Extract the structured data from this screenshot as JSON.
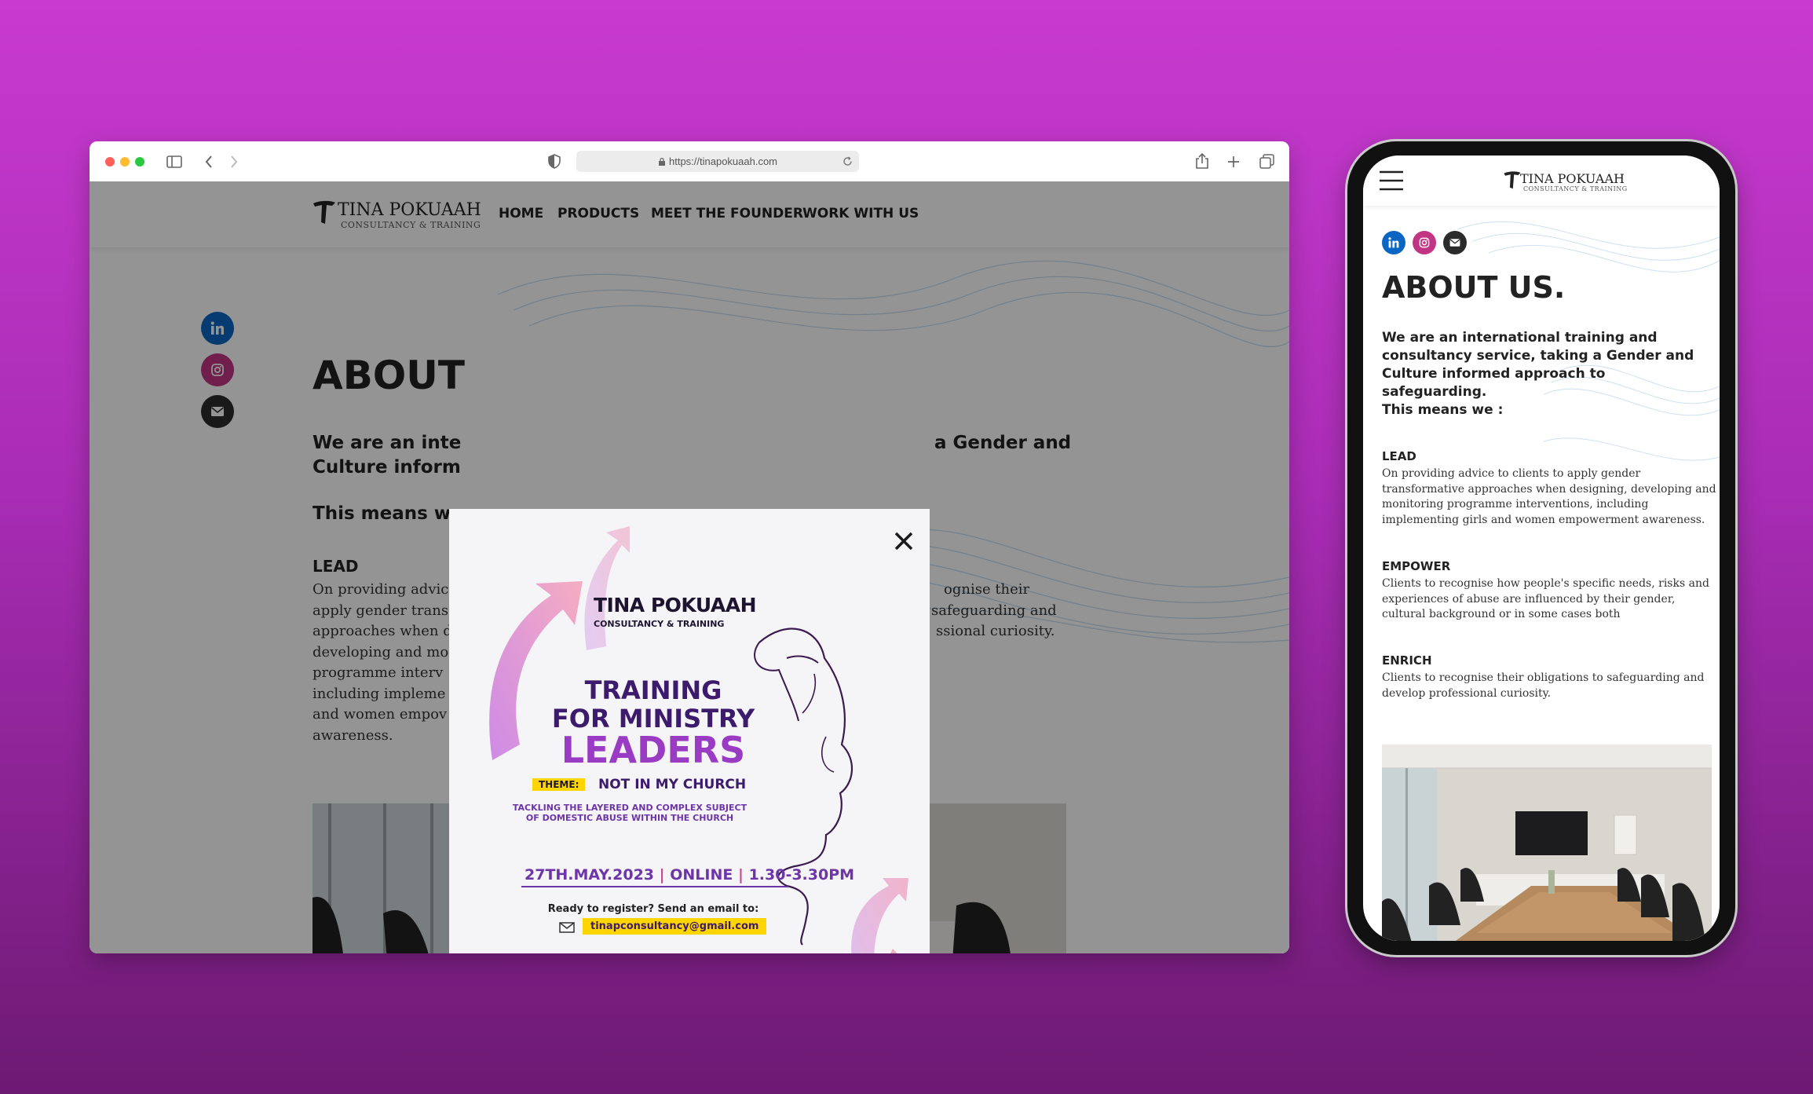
{
  "browser": {
    "url": "https://tinapokuaah.com"
  },
  "brand": {
    "name": "TINA POKUAAH",
    "tagline": "CONSULTANCY & TRAINING"
  },
  "nav": {
    "items": [
      "HOME",
      "PRODUCTS",
      "MEET THE FOUNDER",
      "WORK WITH US"
    ]
  },
  "social": {
    "colors": {
      "linkedin": "#0a66c2",
      "instagram": "#c13584",
      "email": "#2b2b2b"
    }
  },
  "about_desktop": {
    "heading": "ABOUT",
    "lead_left": "We are an inte",
    "lead_left_2": "Culture inform",
    "lead_right": "a Gender and",
    "means": "This means we",
    "lead_title": "LEAD",
    "body_left": [
      "On providing advic",
      "apply gender trans",
      "approaches when d",
      "developing and mo",
      "programme interv",
      "including impleme",
      "and women empov",
      "awareness."
    ],
    "body_right": [
      "ognise their",
      "safeguarding and",
      "ssional curiosity."
    ]
  },
  "popup": {
    "brand": "TINA POKUAAH",
    "brand_sub": "CONSULTANCY & TRAINING",
    "title_1": "TRAINING",
    "title_2": "FOR MINISTRY",
    "title_3": "LEADERS",
    "theme_label": "THEME:",
    "theme_text": "NOT IN MY CHURCH",
    "sub_1": "TACKLING THE LAYERED AND COMPLEX SUBJECT",
    "sub_2": "OF DOMESTIC ABUSE WITHIN THE CHURCH",
    "date": "27TH.MAY.2023",
    "mode": "ONLINE",
    "time": "1.30-3.30PM",
    "ready": "Ready to register? Send an email to:",
    "email": "tinapconsultancy@gmail.com",
    "accent": "#6d35a8",
    "highlight": "#ffd500"
  },
  "about_mobile": {
    "heading": "ABOUT US.",
    "lead": "We are an international training and consultancy service, taking a Gender and Culture informed approach to safeguarding.",
    "means": "This means we :",
    "sections": [
      {
        "title": "LEAD",
        "body": "On providing advice to clients to apply gender transformative approaches when designing, developing and monitoring programme interventions, including implementing girls and women empowerment awareness."
      },
      {
        "title": "EMPOWER",
        "body": "Clients to recognise how people's specific needs, risks and experiences of abuse are influenced by their gender, cultural background or in some cases both"
      },
      {
        "title": "ENRICH",
        "body": "Clients to recognise their obligations to safeguarding and develop professional curiosity."
      }
    ]
  }
}
